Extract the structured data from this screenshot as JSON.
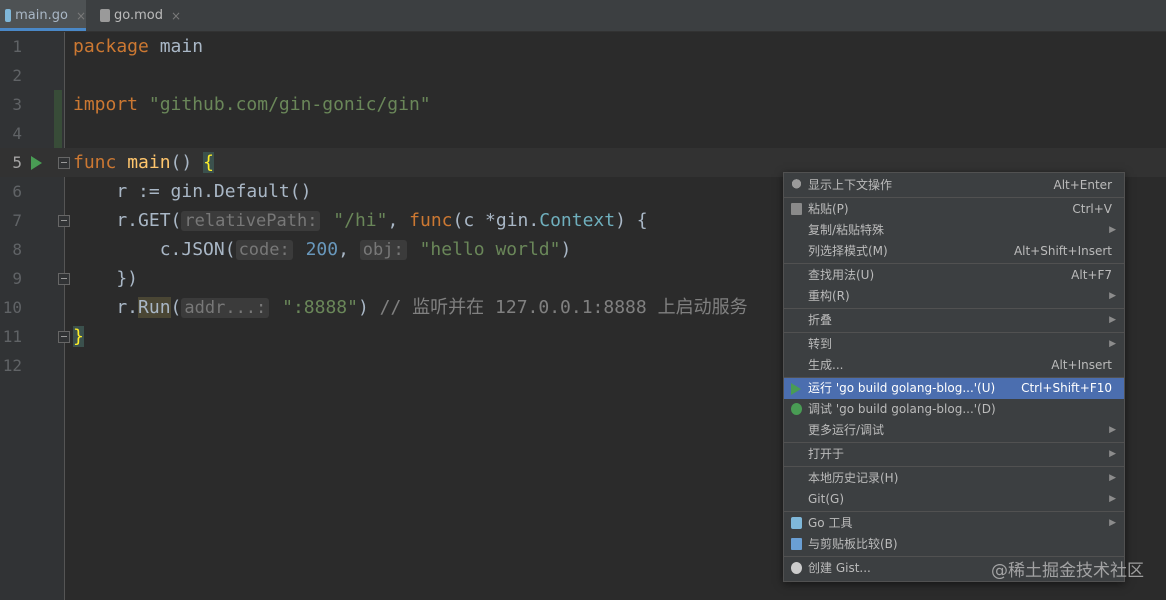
{
  "tabs": [
    {
      "label": "main.go",
      "close": "×"
    },
    {
      "label": "go.mod",
      "close": "×"
    }
  ],
  "editor": {
    "line_numbers": [
      "1",
      "2",
      "3",
      "4",
      "5",
      "6",
      "7",
      "8",
      "9",
      "10",
      "11",
      "12"
    ],
    "line1": {
      "kw": "package",
      "name": " main"
    },
    "line3": {
      "kw": "import",
      "str": " \"github.com/gin-gonic/gin\""
    },
    "line5": {
      "kw": "func",
      "fn": " main",
      "rest": "() ",
      "brace": "{"
    },
    "line6": {
      "a": "    r := ",
      "pkg": "gin",
      "b": ".Default()"
    },
    "line7": {
      "a": "    r.GET(",
      "hint": "relativePath:",
      "str": " \"/hi\"",
      "b": ", ",
      "kw": "func",
      "c": "(c *",
      "pkg": "gin",
      "d": ".",
      "type": "Context",
      "e": ") {"
    },
    "line8": {
      "a": "        c.JSON(",
      "hint1": "code:",
      "num": " 200",
      "b": ", ",
      "hint2": "obj:",
      "str": " \"hello world\"",
      "c": ")"
    },
    "line9": {
      "a": "    })"
    },
    "line10": {
      "a": "    r.",
      "run": "Run",
      "b": "(",
      "hint": "addr...:",
      "str": " \":8888\"",
      "c": ") ",
      "cm": "// 监听并在 127.0.0.1:8888 上启动服务"
    },
    "line11": {
      "brace": "}"
    }
  },
  "context_menu": {
    "items": [
      {
        "label": "显示上下文操作",
        "shortcut": "Alt+Enter",
        "icon": "bulb-icon"
      },
      {
        "label": "粘贴(P)",
        "shortcut": "Ctrl+V",
        "icon": "clipboard-icon"
      },
      {
        "label": "复制/粘贴特殊",
        "submenu": "▶"
      },
      {
        "label": "列选择模式(M)",
        "shortcut": "Alt+Shift+Insert"
      },
      {
        "label": "查找用法(U)",
        "shortcut": "Alt+F7"
      },
      {
        "label": "重构(R)",
        "submenu": "▶"
      },
      {
        "label": "折叠",
        "submenu": "▶"
      },
      {
        "label": "转到",
        "submenu": "▶"
      },
      {
        "label": "生成...",
        "shortcut": "Alt+Insert"
      },
      {
        "label": "运行 'go build golang-blog...'(U)",
        "shortcut": "Ctrl+Shift+F10",
        "icon": "run-icon"
      },
      {
        "label": "调试 'go build golang-blog...'(D)",
        "icon": "debug-icon"
      },
      {
        "label": "更多运行/调试",
        "submenu": "▶"
      },
      {
        "label": "打开于",
        "submenu": "▶"
      },
      {
        "label": "本地历史记录(H)",
        "submenu": "▶"
      },
      {
        "label": "Git(G)",
        "submenu": "▶"
      },
      {
        "label": "Go 工具",
        "submenu": "▶",
        "icon": "go-file-icon"
      },
      {
        "label": "与剪贴板比较(B)",
        "icon": "compare-icon"
      },
      {
        "label": "创建 Gist...",
        "icon": "github-icon"
      }
    ]
  },
  "watermark": "@稀土掘金技术社区",
  "colors": {
    "selection": "#4b6eaf",
    "keyword": "#cc7832",
    "string": "#6a8759",
    "function": "#ffc66d",
    "number": "#6897bb"
  }
}
